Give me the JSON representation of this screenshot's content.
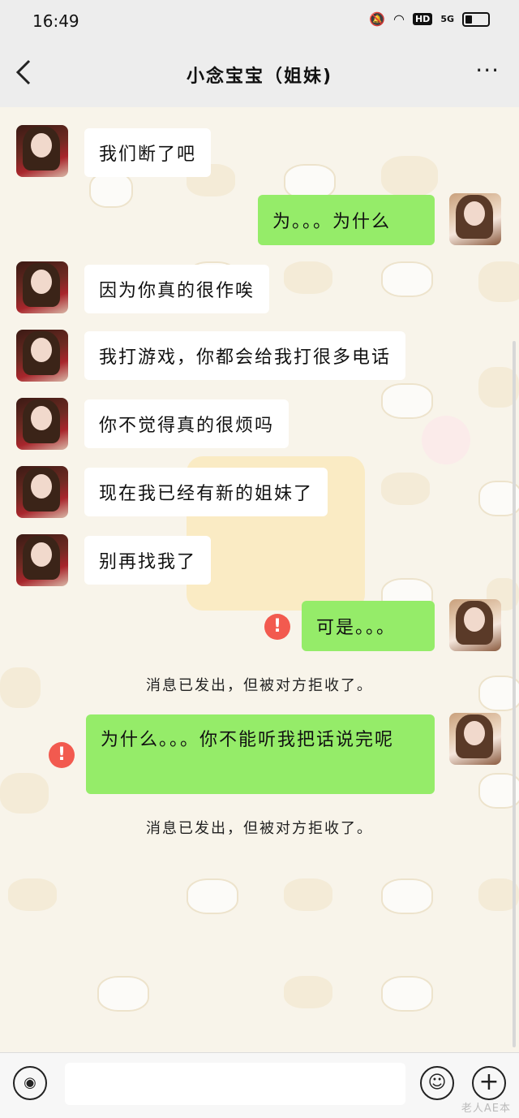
{
  "status": {
    "time": "16:49",
    "signal": "5G",
    "hd": "HD"
  },
  "nav": {
    "back": "<",
    "title": "小念宝宝（姐妹)",
    "more": "···"
  },
  "messages": [
    {
      "side": "left",
      "text": "我们断了吧"
    },
    {
      "side": "right",
      "text": "为。。。为什么"
    },
    {
      "side": "left",
      "text": "因为你真的很作唉"
    },
    {
      "side": "left",
      "text": "我打游戏，你都会给我打很多电话"
    },
    {
      "side": "left",
      "text": "你不觉得真的很烦吗"
    },
    {
      "side": "left",
      "text": "现在我已经有新的姐妹了"
    },
    {
      "side": "left",
      "text": "别再找我了"
    },
    {
      "side": "right",
      "text": "可是。。。",
      "failed": true
    },
    {
      "side": "right",
      "text": "为什么。。。你不能听我把话说完呢",
      "failed": true
    }
  ],
  "system": {
    "rejected_1": "消息已发出，但被对方拒收了。",
    "rejected_2": "消息已发出，但被对方拒收了。"
  },
  "warn_symbol": "!",
  "input": {
    "voice_icon": "voice-icon",
    "emoji_icon": "emoji-icon",
    "plus_icon": "plus-icon"
  },
  "watermark": "老人AE本"
}
